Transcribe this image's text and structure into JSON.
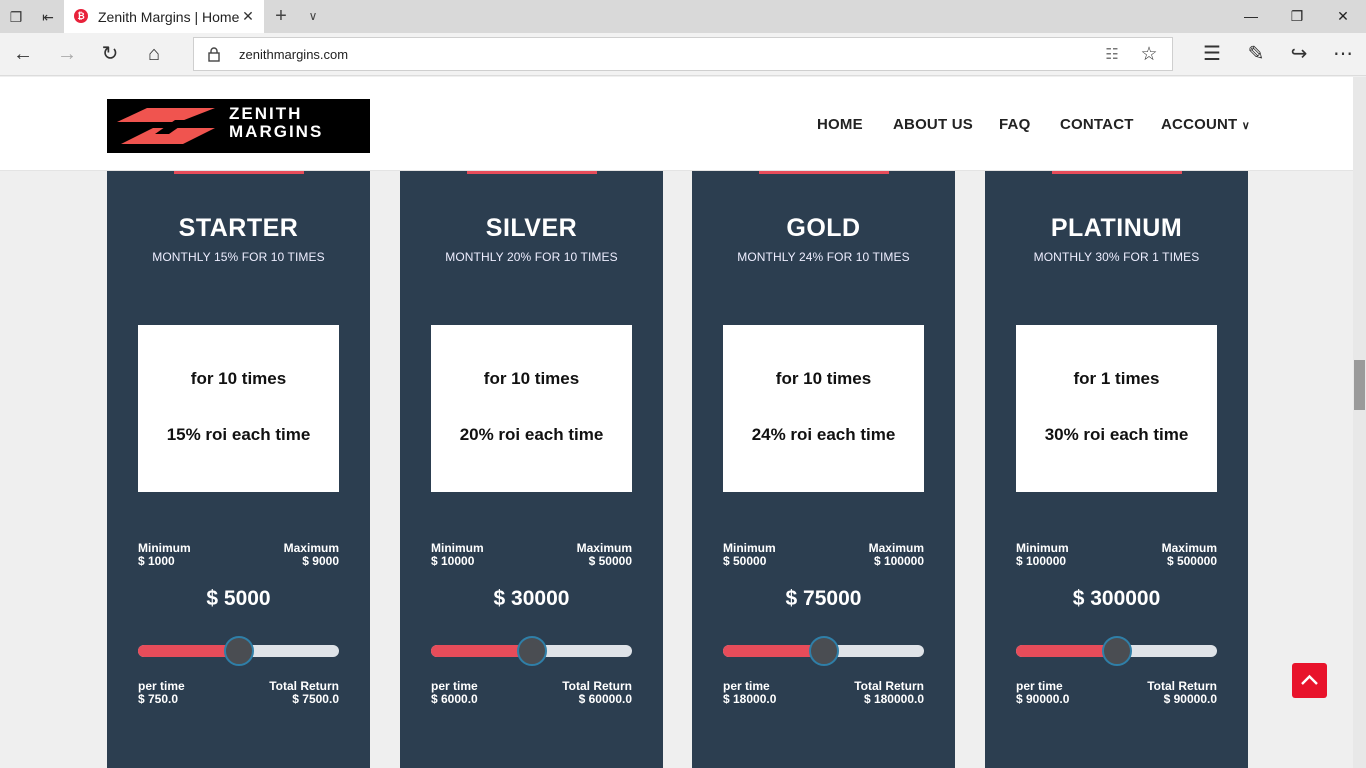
{
  "browser": {
    "tab_title": "Zenith Margins | Home",
    "tab_favicon": "₿",
    "url": "zenithmargins.com"
  },
  "site": {
    "logo": {
      "line1": "ZENITH",
      "line2": "MARGINS"
    },
    "menu": [
      "HOME",
      "ABOUT US",
      "FAQ",
      "CONTACT",
      "ACCOUNT"
    ],
    "accent_color": "#e74c5a",
    "card_color": "#2c3e50"
  },
  "plans": [
    {
      "name": "STARTER",
      "subtitle": "MONTHLY 15% FOR 10 TIMES",
      "times_text": "for 10 times",
      "roi_text": "15% roi each time",
      "min_label": "Minimum",
      "min_value": "$ 1000",
      "max_label": "Maximum",
      "max_value": "$ 9000",
      "amount": "$ 5000",
      "slider_fraction": 0.5,
      "per_time_label": "per time",
      "per_time_value": "$ 750.0",
      "total_label": "Total Return",
      "total_value": "$ 7500.0"
    },
    {
      "name": "SILVER",
      "subtitle": "MONTHLY 20% FOR 10 TIMES",
      "times_text": "for 10 times",
      "roi_text": "20% roi each time",
      "min_label": "Minimum",
      "min_value": "$ 10000",
      "max_label": "Maximum",
      "max_value": "$ 50000",
      "amount": "$ 30000",
      "slider_fraction": 0.5,
      "per_time_label": "per time",
      "per_time_value": "$ 6000.0",
      "total_label": "Total Return",
      "total_value": "$ 60000.0"
    },
    {
      "name": "GOLD",
      "subtitle": "MONTHLY 24% FOR 10 TIMES",
      "times_text": "for 10 times",
      "roi_text": "24% roi each time",
      "min_label": "Minimum",
      "min_value": "$ 50000",
      "max_label": "Maximum",
      "max_value": "$ 100000",
      "amount": "$ 75000",
      "slider_fraction": 0.5,
      "per_time_label": "per time",
      "per_time_value": "$ 18000.0",
      "total_label": "Total Return",
      "total_value": "$ 180000.0"
    },
    {
      "name": "PLATINUM",
      "subtitle": "MONTHLY 30% FOR 1 TIMES",
      "times_text": "for 1 times",
      "roi_text": "30% roi each time",
      "min_label": "Minimum",
      "min_value": "$ 100000",
      "max_label": "Maximum",
      "max_value": "$ 500000",
      "amount": "$ 300000",
      "slider_fraction": 0.5,
      "per_time_label": "per time",
      "per_time_value": "$ 90000.0",
      "total_label": "Total Return",
      "total_value": "$ 90000.0"
    }
  ]
}
